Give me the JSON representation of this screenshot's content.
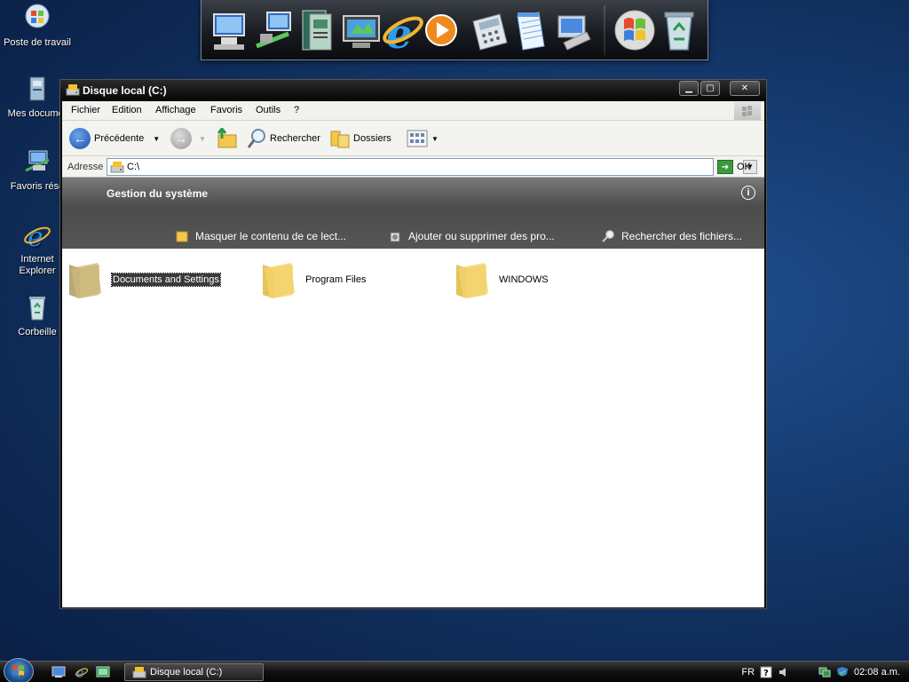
{
  "desktop": {
    "icons": [
      {
        "label": "Poste de travail",
        "icon": "computer-icon"
      },
      {
        "label": "Mes documer",
        "icon": "documents-icon"
      },
      {
        "label": "Favoris rése",
        "icon": "network-places-icon"
      },
      {
        "label": "Internet Explorer",
        "icon": "internet-explorer-icon"
      },
      {
        "label": "Corbeille",
        "icon": "recycle-bin-icon"
      }
    ]
  },
  "dock": {
    "items": [
      "computer-icon",
      "network-icon",
      "documents-icon",
      "monitor-icon",
      "internet-explorer-icon",
      "media-player-icon",
      "calculator-icon",
      "notepad-icon",
      "control-panel-icon",
      "windows-logo-icon",
      "recycle-bin-icon"
    ]
  },
  "window": {
    "title": "Disque local (C:)",
    "menu": [
      "Fichier",
      "Edition",
      "Affichage",
      "Favoris",
      "Outils",
      "?"
    ],
    "toolbar": {
      "back_label": "Précédente",
      "search_label": "Rechercher",
      "folders_label": "Dossiers"
    },
    "address": {
      "label": "Adresse",
      "value": "C:\\",
      "go_label": "OK"
    },
    "taskpane": {
      "heading": "Gestion du système",
      "tasks": [
        "Masquer le contenu de ce lect...",
        "Ajouter ou supprimer des pro...",
        "Rechercher des fichiers..."
      ]
    },
    "folders": [
      {
        "name": "Documents and Settings",
        "selected": true
      },
      {
        "name": "Program Files",
        "selected": false
      },
      {
        "name": "WINDOWS",
        "selected": false
      }
    ]
  },
  "taskbar": {
    "task_button": "Disque local (C:)",
    "language": "FR",
    "clock": "02:08 a.m."
  },
  "colors": {
    "desktop_bg": "#163c72",
    "titlebar": "#050505",
    "selection": "#3a3a3a"
  }
}
